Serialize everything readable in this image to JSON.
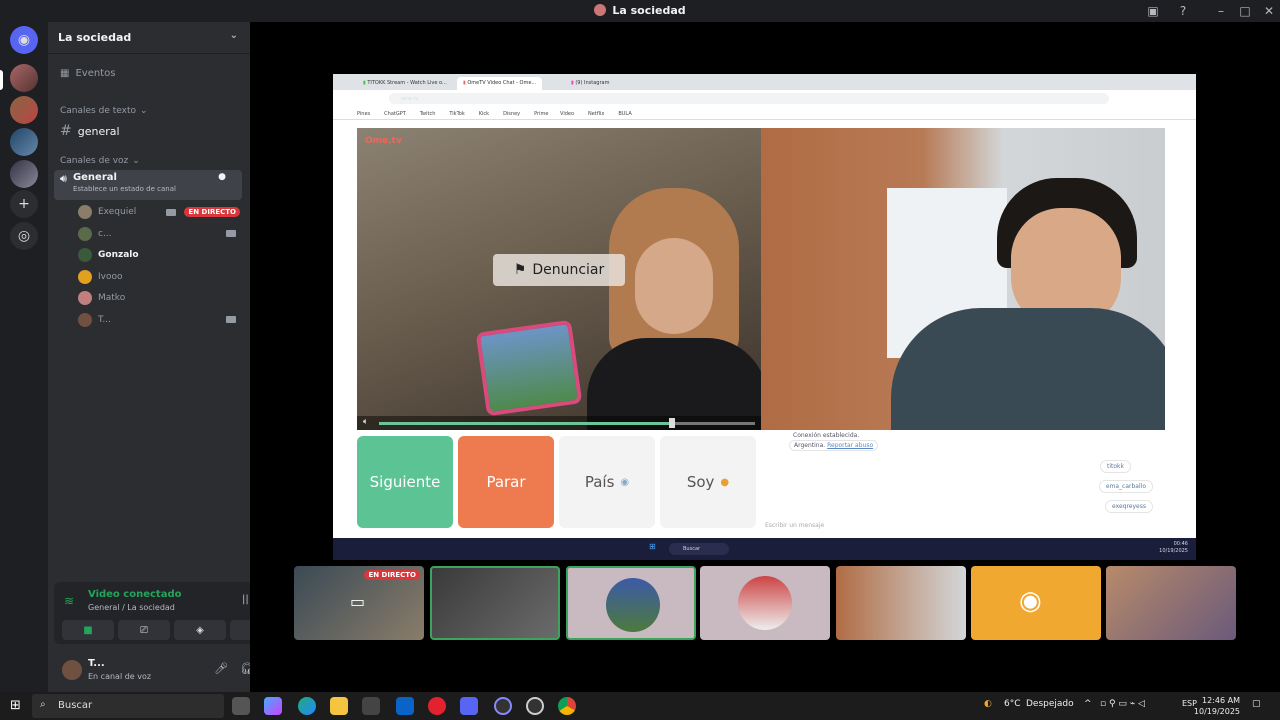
{
  "window": {
    "title": "La sociedad"
  },
  "server": {
    "name": "La sociedad"
  },
  "sidebar": {
    "events_label": "Eventos",
    "text_category": "Canales de texto",
    "text_channels": [
      "general"
    ],
    "voice_category": "Canales de voz",
    "voice_channel": {
      "name": "General",
      "status": "Establece un estado de canal"
    },
    "members": [
      {
        "name": "Exequiel",
        "live": "EN DIRECTO",
        "camera": true,
        "color": "#8a7d6a"
      },
      {
        "name": "c...",
        "live": "",
        "camera": true,
        "color": "#5a6a4a"
      },
      {
        "name": "Gonzalo",
        "live": "",
        "camera": false,
        "color": "#3a5a3a"
      },
      {
        "name": "Ivooo",
        "live": "",
        "camera": false,
        "color": "#e0a020"
      },
      {
        "name": "Matko",
        "live": "",
        "camera": false,
        "color": "#c08080"
      },
      {
        "name": "T...",
        "live": "",
        "camera": true,
        "color": "#705040"
      }
    ]
  },
  "voice_panel": {
    "status": "Video conectado",
    "channel": "General / La sociedad"
  },
  "user": {
    "name": "T...",
    "status": "En canal de voz"
  },
  "stream": {
    "browser_tabs": [
      "TITOKK Stream - Watch Live o...",
      "OmeTV Video Chat - Ome...",
      "(9) Instagram"
    ],
    "url": "ome.tv",
    "bookmarks": [
      "Pines",
      "ChatGPT",
      "Twitch",
      "TikTok",
      "Kick",
      "Disney",
      "Prime Video",
      "Netflix",
      "BULA"
    ],
    "logo": "Ome.tv",
    "report_button": "Denunciar",
    "buttons": {
      "next": "Siguiente",
      "stop": "Parar",
      "country": "País",
      "gender": "Soy"
    },
    "chat_system": "Conexión establecida.",
    "chat_country": "Argentina.",
    "chat_report": "Reportar abuso",
    "chat_messages": [
      "titokk",
      "ema_carballo",
      "exeqreyess"
    ],
    "chat_placeholder": "Escribir un mensaje",
    "taskbar_search": "Buscar",
    "taskbar_time": "00:46",
    "taskbar_date": "10/19/2025",
    "volume_progress": 0.78
  },
  "thumbs": {
    "live_badge": "EN DIRECTO"
  },
  "taskbar": {
    "search_placeholder": "Buscar",
    "weather_temp": "6°C",
    "weather_desc": "Despejado",
    "lang": "ESP",
    "time": "12:46 AM",
    "date": "10/19/2025"
  }
}
